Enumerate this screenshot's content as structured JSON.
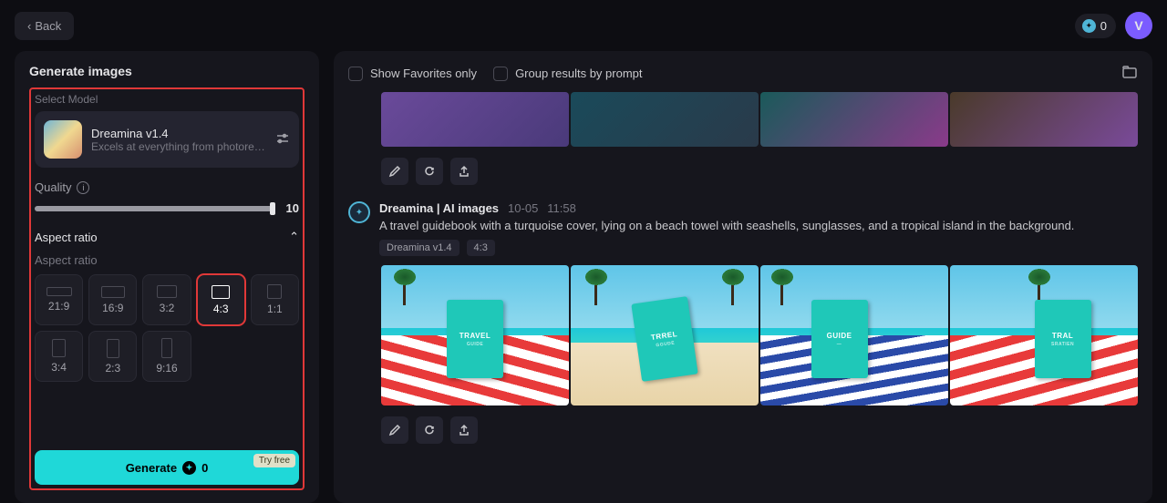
{
  "header": {
    "back_label": "Back",
    "credits_value": "0",
    "avatar_letter": "V"
  },
  "left": {
    "title": "Generate images",
    "select_model_label": "Select Model",
    "model": {
      "name": "Dreamina v1.4",
      "desc": "Excels at everything from photoreali..."
    },
    "quality_label": "Quality",
    "quality_value": "10",
    "aspect_header": "Aspect ratio",
    "aspect_sub": "Aspect ratio",
    "ratios": [
      "21:9",
      "16:9",
      "3:2",
      "4:3",
      "1:1",
      "3:4",
      "2:3",
      "9:16"
    ],
    "selected_ratio": "4:3",
    "generate_label": "Generate",
    "generate_cost": "0",
    "generate_badge": "Try free"
  },
  "right": {
    "filter_favorites": "Show Favorites only",
    "filter_group": "Group results by prompt",
    "generation": {
      "title": "Dreamina | AI images",
      "date": "10-05",
      "time": "11:58",
      "prompt": "A travel guidebook with a turquoise cover, lying on a beach towel with seashells, sunglasses, and a tropical island in the background.",
      "tags": [
        "Dreamina v1.4",
        "4:3"
      ]
    }
  }
}
